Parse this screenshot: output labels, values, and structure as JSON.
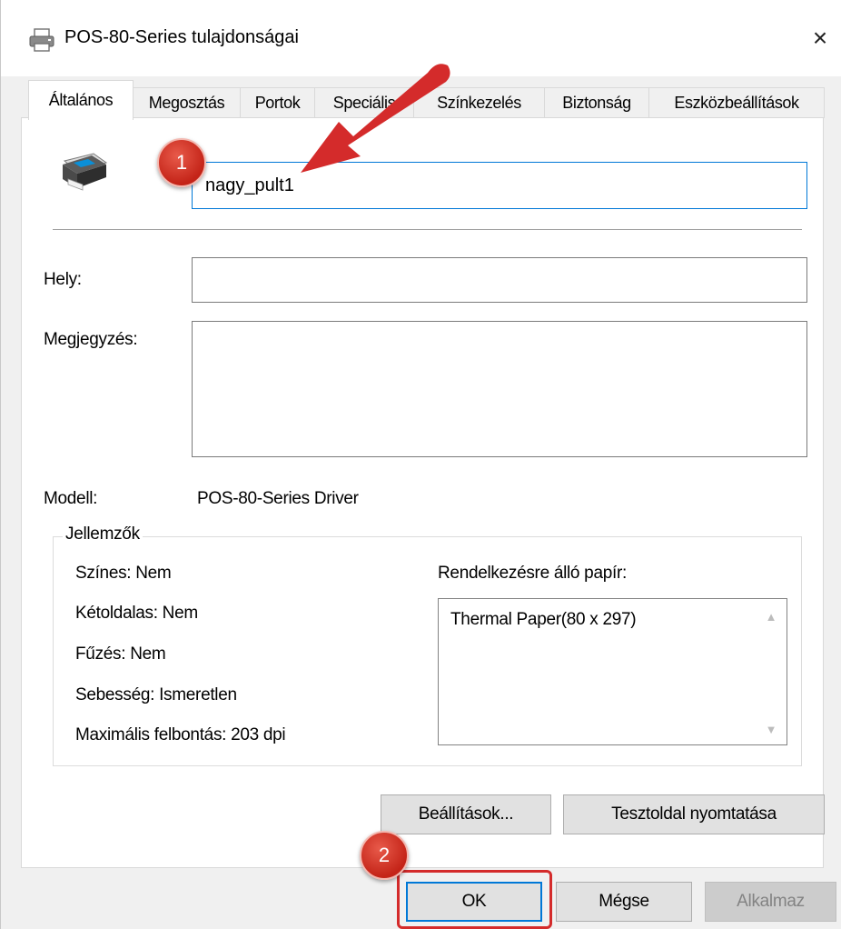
{
  "window": {
    "title": "POS-80-Series tulajdonságai",
    "close_label": "×"
  },
  "tabs": [
    {
      "label": "Általános",
      "active": true
    },
    {
      "label": "Megosztás",
      "active": false
    },
    {
      "label": "Portok",
      "active": false
    },
    {
      "label": "Speciális",
      "active": false
    },
    {
      "label": "Színkezelés",
      "active": false
    },
    {
      "label": "Biztonság",
      "active": false
    },
    {
      "label": "Eszközbeállítások",
      "active": false
    }
  ],
  "general": {
    "printer_name": "nagy_pult1",
    "location_label": "Hely:",
    "location_value": "",
    "comment_label": "Megjegyzés:",
    "comment_value": "",
    "model_label": "Modell:",
    "model_value": "POS-80-Series Driver"
  },
  "features": {
    "group_title": "Jellemzők",
    "color": "Színes: Nem",
    "duplex": "Kétoldalas: Nem",
    "staple": "Fűzés: Nem",
    "speed": "Sebesség: Ismeretlen",
    "max_resolution": "Maximális felbontás: 203 dpi",
    "paper_label": "Rendelkezésre álló papír:",
    "paper_items": [
      "Thermal Paper(80 x 297)"
    ]
  },
  "buttons": {
    "preferences": "Beállítások...",
    "print_test_page": "Tesztoldal nyomtatása",
    "ok": "OK",
    "cancel": "Mégse",
    "apply": "Alkalmaz"
  },
  "annotations": {
    "step1": "1",
    "step2": "2",
    "accent_color": "#d42b2b"
  }
}
